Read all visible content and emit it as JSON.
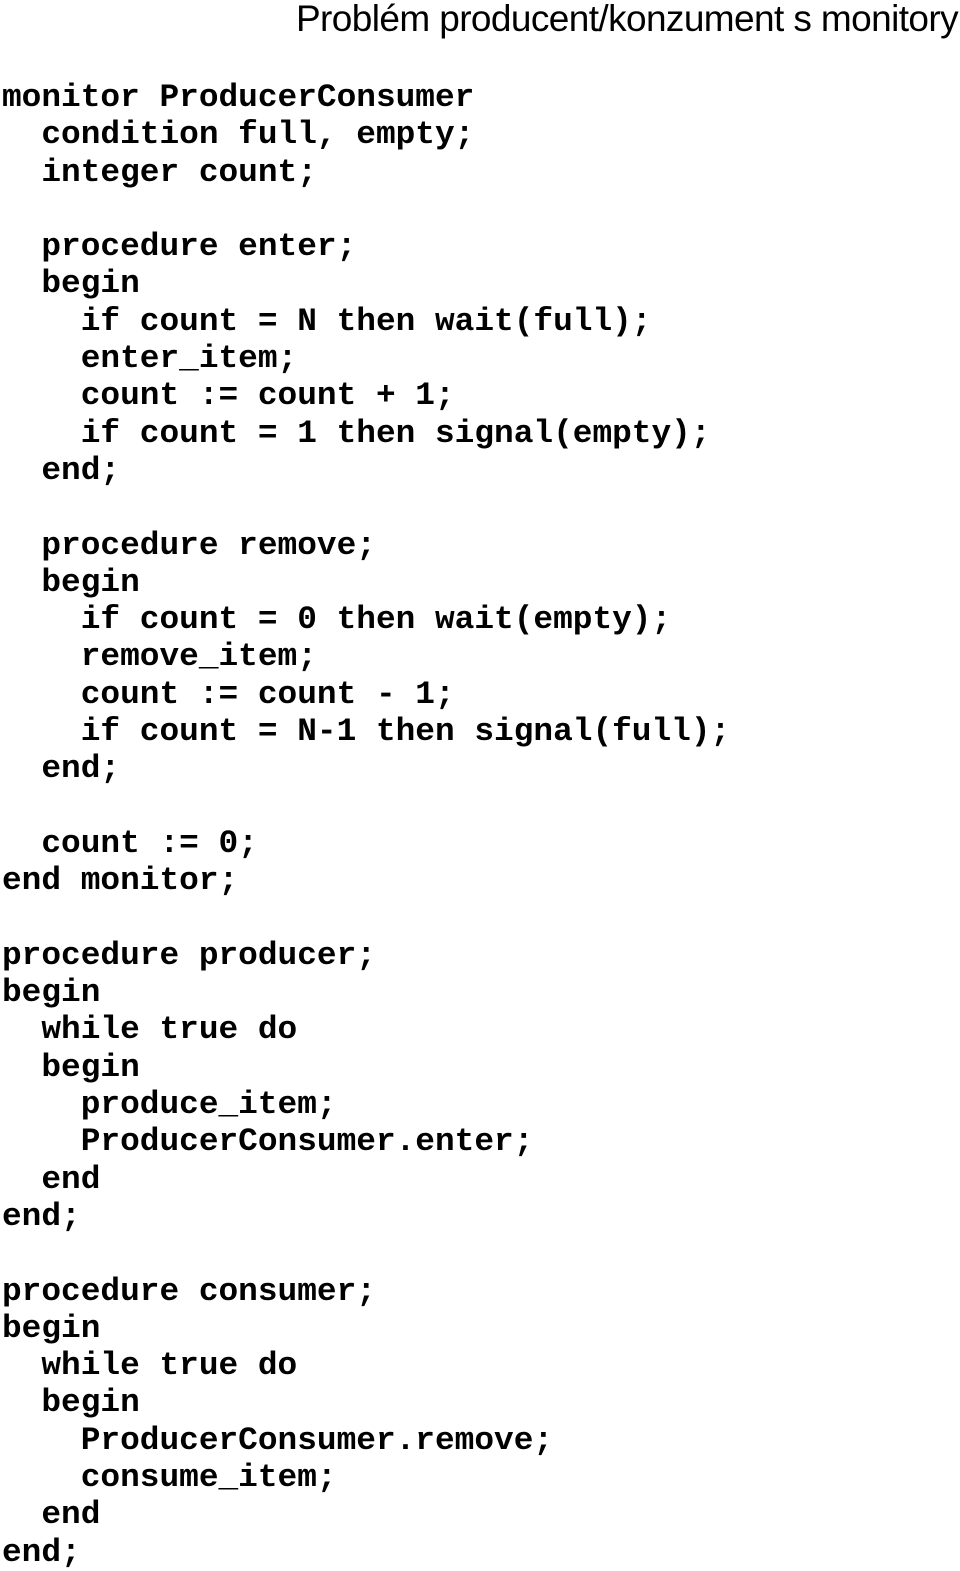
{
  "title": "Problém producent/konzument s monitory",
  "code_lines": [
    "monitor ProducerConsumer",
    "  condition full, empty;",
    "  integer count;",
    "",
    "  procedure enter;",
    "  begin",
    "    if count = N then wait(full);",
    "    enter_item;",
    "    count := count + 1;",
    "    if count = 1 then signal(empty);",
    "  end;",
    "",
    "  procedure remove;",
    "  begin",
    "    if count = 0 then wait(empty);",
    "    remove_item;",
    "    count := count - 1;",
    "    if count = N-1 then signal(full);",
    "  end;",
    "",
    "  count := 0;",
    "end monitor;",
    "",
    "procedure producer;",
    "begin",
    "  while true do",
    "  begin",
    "    produce_item;",
    "    ProducerConsumer.enter;",
    "  end",
    "end;",
    "",
    "procedure consumer;",
    "begin",
    "  while true do",
    "  begin",
    "    ProducerConsumer.remove;",
    "    consume_item;",
    "  end",
    "end;"
  ]
}
